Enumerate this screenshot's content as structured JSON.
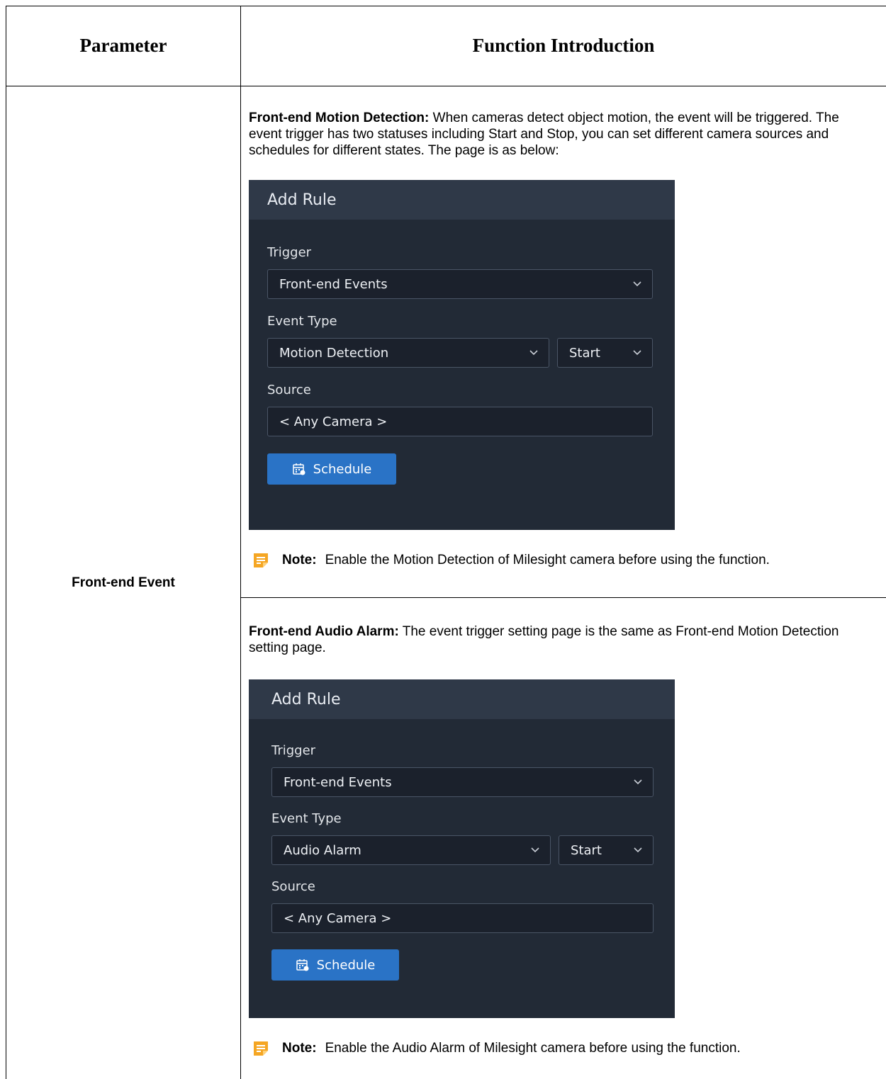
{
  "table": {
    "header_parameter": "Parameter",
    "header_function": "Function Introduction",
    "parameter_name": "Front-end Event"
  },
  "motion": {
    "title": "Front-end Motion Detection:",
    "text": " When cameras detect object motion, the event will be triggered. The event trigger has two statuses including Start and Stop, you can set different camera sources and schedules for different states. The page is as below:",
    "panel": {
      "title": "Add Rule",
      "trigger_label": "Trigger",
      "trigger_value": "Front-end Events",
      "event_type_label": "Event Type",
      "event_type_value": "Motion Detection",
      "state_value": "Start",
      "source_label": "Source",
      "source_value": "< Any Camera >",
      "schedule_label": "Schedule"
    },
    "note_label": "Note:",
    "note_text": "Enable the Motion Detection of Milesight camera before using the function."
  },
  "audio": {
    "title": "Front-end Audio Alarm:",
    "text": " The event trigger setting page is the same as Front-end Motion Detection setting page.",
    "panel": {
      "title": "Add Rule",
      "trigger_label": "Trigger",
      "trigger_value": "Front-end Events",
      "event_type_label": "Event Type",
      "event_type_value": "Audio Alarm",
      "state_value": "Start",
      "source_label": "Source",
      "source_value": "< Any Camera >",
      "schedule_label": "Schedule"
    },
    "note_label": "Note:",
    "note_text": "Enable the Audio Alarm of Milesight camera before using the function."
  },
  "colors": {
    "panel_bg": "#222a36",
    "panel_header": "#2f3948",
    "button_blue": "#2a73c6",
    "note_orange": "#f5a623"
  }
}
